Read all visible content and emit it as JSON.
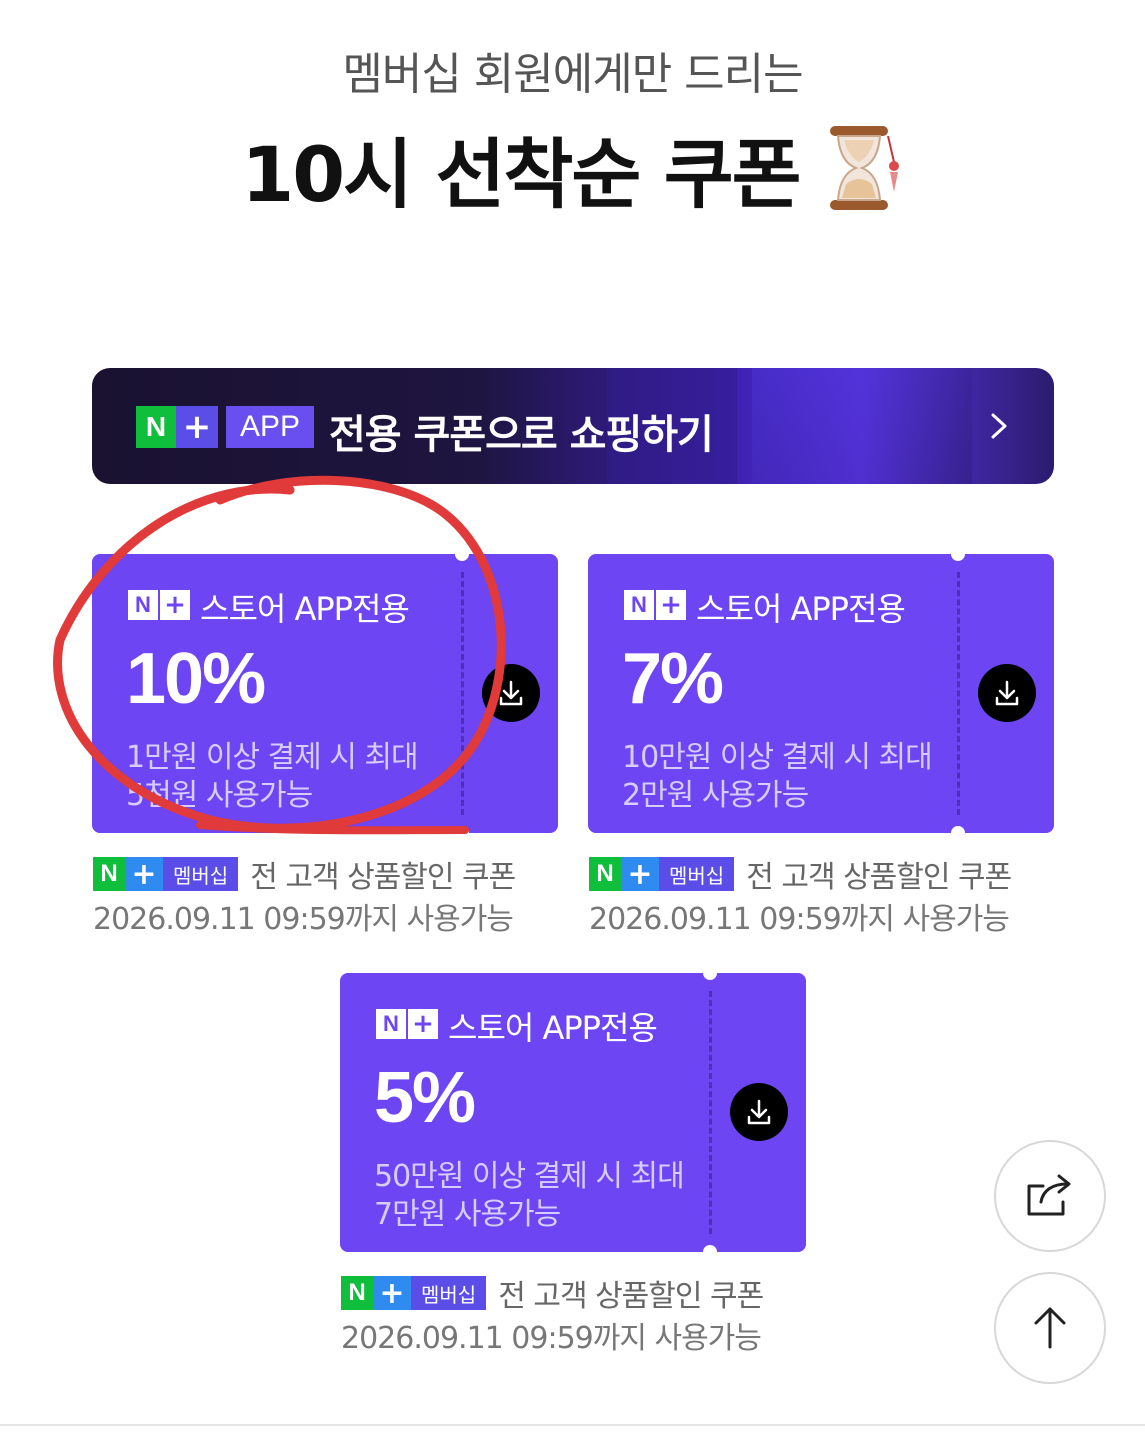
{
  "header": {
    "subtitle": "멤버십 회원에게만 드리는",
    "title": "10시 선착순 쿠폰",
    "title_icon": "hourglass-icon"
  },
  "banner": {
    "logo_n": "N",
    "logo_plus": "+",
    "app_label": "APP",
    "text": "전용 쿠폰으로 쇼핑하기",
    "chevron_icon": "chevron-right-icon"
  },
  "coupons": [
    {
      "badge_n": "N",
      "badge_plus": "+",
      "store_label": "스토어 APP전용",
      "percent": "10%",
      "desc_line1": "1만원 이상 결제 시 최대",
      "desc_line2": "5천원 사용가능",
      "tag_n": "N",
      "tag_plus": "+",
      "tag_label": "멤버십",
      "caption": "전 고객 상품할인 쿠폰",
      "expiry": "2026.09.11 09:59까지 사용가능"
    },
    {
      "badge_n": "N",
      "badge_plus": "+",
      "store_label": "스토어 APP전용",
      "percent": "7%",
      "desc_line1": "10만원 이상 결제 시 최대",
      "desc_line2": "2만원 사용가능",
      "tag_n": "N",
      "tag_plus": "+",
      "tag_label": "멤버십",
      "caption": "전 고객 상품할인 쿠폰",
      "expiry": "2026.09.11 09:59까지 사용가능"
    },
    {
      "badge_n": "N",
      "badge_plus": "+",
      "store_label": "스토어 APP전용",
      "percent": "5%",
      "desc_line1": "50만원 이상 결제 시 최대",
      "desc_line2": "7만원 사용가능",
      "tag_n": "N",
      "tag_plus": "+",
      "tag_label": "멤버십",
      "caption": "전 고객 상품할인 쿠폰",
      "expiry": "2026.09.11 09:59까지 사용가능"
    }
  ],
  "colors": {
    "coupon_bg": "#6d45f2",
    "naver_green": "#0fbf3b",
    "annotation_red": "#e03a3a"
  },
  "fab": {
    "share_icon": "share-icon",
    "top_icon": "arrow-up-icon"
  }
}
